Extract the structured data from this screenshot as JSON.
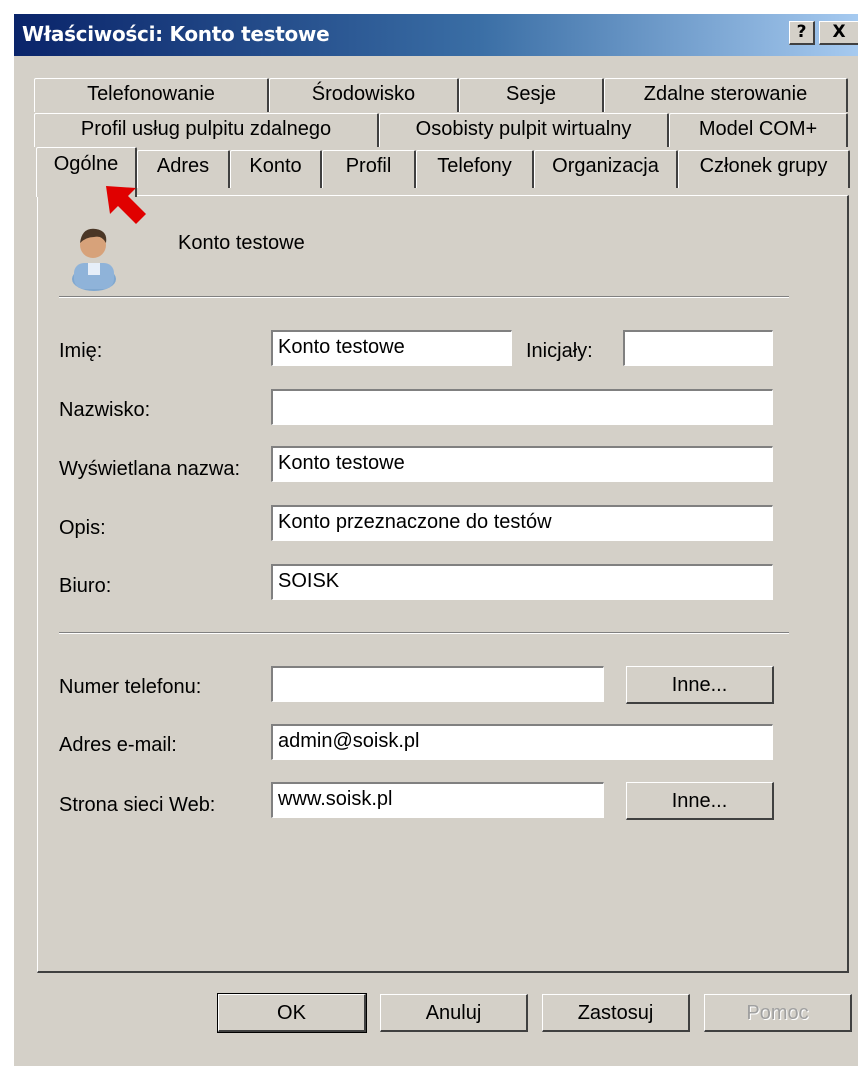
{
  "window": {
    "title": "Właściwości: Konto testowe",
    "help_glyph": "?",
    "close_glyph": "X"
  },
  "tabs": {
    "row1": [
      "Telefonowanie",
      "Środowisko",
      "Sesje",
      "Zdalne sterowanie"
    ],
    "row2": [
      "Profil usług pulpitu zdalnego",
      "Osobisty pulpit wirtualny",
      "Model COM+"
    ],
    "row3": [
      "Ogólne",
      "Adres",
      "Konto",
      "Profil",
      "Telefony",
      "Organizacja",
      "Członek grupy"
    ],
    "active": "Ogólne"
  },
  "header": {
    "icon": "user-icon",
    "account_name": "Konto testowe",
    "annotation_icon": "red-arrow-icon",
    "annotation_color": "#e00000"
  },
  "form": {
    "first_name_label": "Imię:",
    "first_name_value": "Konto testowe",
    "initials_label": "Inicjały:",
    "initials_value": "",
    "last_name_label": "Nazwisko:",
    "last_name_value": "",
    "display_name_label": "Wyświetlana nazwa:",
    "display_name_value": "Konto testowe",
    "description_label": "Opis:",
    "description_value": "Konto przeznaczone do testów",
    "office_label": "Biuro:",
    "office_value": "SOISK",
    "phone_label": "Numer telefonu:",
    "phone_value": "",
    "phone_other_button": "Inne...",
    "email_label": "Adres e-mail:",
    "email_value": "admin@soisk.pl",
    "web_label": "Strona sieci Web:",
    "web_value": "www.soisk.pl",
    "web_other_button": "Inne..."
  },
  "buttons": {
    "ok": "OK",
    "cancel": "Anuluj",
    "apply": "Zastosuj",
    "help": "Pomoc"
  },
  "colors": {
    "titlebar_start": "#0a246a",
    "titlebar_end": "#a6caf0",
    "dialog_face": "#d4d0c8"
  }
}
